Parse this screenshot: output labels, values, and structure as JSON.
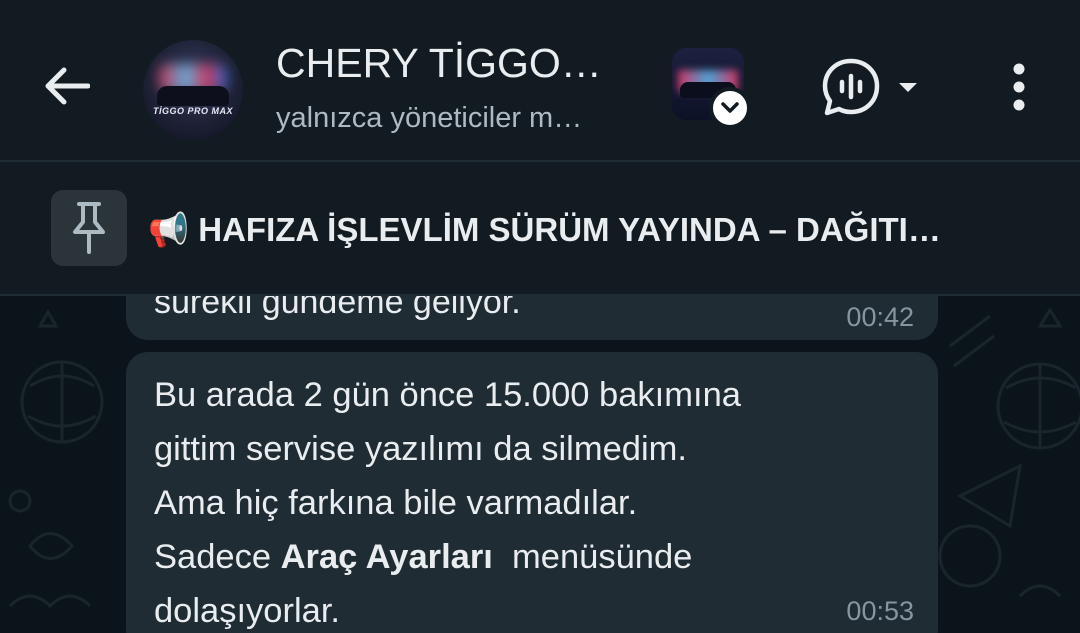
{
  "header": {
    "back_icon": "arrow-back-icon",
    "title": "CHERY TİGGO…",
    "subtitle": "yalnızca yöneticiler m…",
    "avatar_brand": "TİGGO PRO MAX",
    "channel_badge_icon": "chevron-down-icon",
    "voice_icon": "voice-chat-icon",
    "menu_icon": "more-vertical-icon"
  },
  "pinned": {
    "icon": "pin-icon",
    "text": "📢 HAFIZA İŞLEVLİM SÜRÜM YAYINDA – DAĞITI…"
  },
  "messages": [
    {
      "text": "sürekli gündeme geliyor.",
      "time": "00:42"
    },
    {
      "line1": "Bu arada 2 gün önce 15.000 bakımına",
      "line2": "gittim servise yazılımı da silmedim.",
      "line3": "Ama hiç farkına bile varmadılar.",
      "line4_pre": "Sadece ",
      "line4_bold": "Araç Ayarları",
      "line4_post": "  menüsünde",
      "line5": "dolaşıyorlar.",
      "time": "00:53"
    }
  ],
  "colors": {
    "background": "#0b141a",
    "header": "#111b21",
    "bubble": "#202c33",
    "text": "#e9edef",
    "secondary_text": "#aebac1",
    "timestamp": "#8696a0"
  }
}
